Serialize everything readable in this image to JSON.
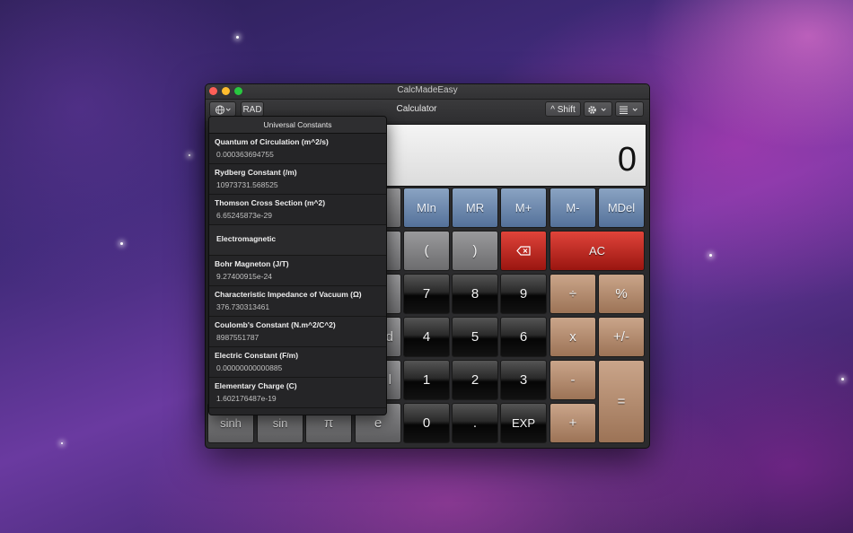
{
  "window": {
    "app_title": "CalcMadeEasy",
    "toolbar_title": "Calculator"
  },
  "toolbar": {
    "globe_icon": "globe-icon",
    "angle_mode": "RAD",
    "shift_label": "^ Shift",
    "gear_icon": "gear-icon",
    "list_icon": "list-icon"
  },
  "display": {
    "value": "0"
  },
  "keys": {
    "mem": [
      "MIn",
      "MR",
      "M+",
      "M-",
      "MDel"
    ],
    "paren_open": "(",
    "paren_close": ")",
    "backspace_icon": "backspace-icon",
    "ac": "AC",
    "divide": "÷",
    "percent": "%",
    "multiply": "x",
    "plus_minus": "+/-",
    "minus": "-",
    "plus": "+",
    "equals": "=",
    "digits": [
      "7",
      "8",
      "9",
      "4",
      "5",
      "6",
      "1",
      "2",
      "3",
      "0"
    ],
    "dot": ".",
    "exp": "EXP",
    "sci": [
      "sinh",
      "sin",
      "π",
      "e"
    ],
    "partial_d": "d",
    "partial_l": "l"
  },
  "constants_menu": {
    "header": "Universal Constants",
    "items": [
      {
        "name": "Quantum of Circulation (m^2/s)",
        "value": "0.000363694755"
      },
      {
        "name": "Rydberg Constant (/m)",
        "value": "10973731.568525"
      },
      {
        "name": "Thomson Cross Section (m^2)",
        "value": "6.65245873e-29"
      }
    ],
    "section": "Electromagnetic",
    "items2": [
      {
        "name": "Bohr Magneton (J/T)",
        "value": "9.27400915e-24"
      },
      {
        "name": "Characteristic Impedance of Vacuum (Ω)",
        "value": "376.730313461"
      },
      {
        "name": "Coulomb's Constant (N.m^2/C^2)",
        "value": "8987551787"
      },
      {
        "name": "Electric Constant (F/m)",
        "value": "0.00000000000885"
      },
      {
        "name": "Elementary Charge (C)",
        "value": "1.602176487e-19"
      }
    ]
  }
}
